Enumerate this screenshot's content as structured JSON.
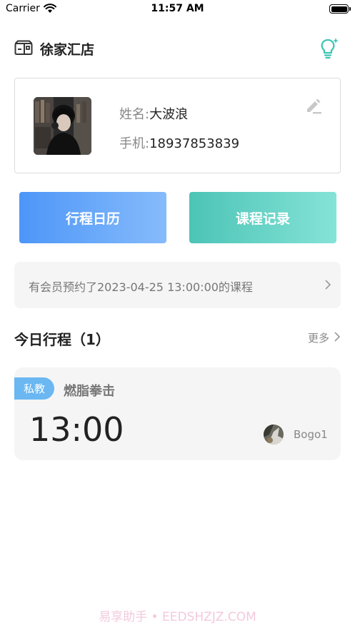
{
  "status_bar": {
    "carrier": "Carrier",
    "time": "11:57 AM",
    "icons": [
      "wifi-icon",
      "battery-icon"
    ]
  },
  "header": {
    "store_name": "徐家汇店",
    "store_icon": "store-icon",
    "action_icon": "lightbulb-icon"
  },
  "profile": {
    "name_label": "姓名:",
    "name_value": "大波浪",
    "phone_label": "手机:",
    "phone_value": "18937853839",
    "edit_icon": "pencil-icon"
  },
  "actions": {
    "schedule_calendar": "行程日历",
    "course_records": "课程记录"
  },
  "notice": {
    "text": "有会员预约了2023-04-25 13:00:00的课程"
  },
  "today": {
    "title": "今日行程（1）",
    "more": "更多",
    "items": [
      {
        "tag": "私教",
        "course": "燃脂拳击",
        "time": "13:00",
        "coach": "Bogo1"
      }
    ]
  },
  "colors": {
    "schedule_button": "#4d96f8",
    "records_button": "#4cc4b6",
    "tag": "#6ab7f2",
    "bulb_accent": "#3cc4b4"
  },
  "watermark": "易享助手 • EEDSHZJZ.COM"
}
